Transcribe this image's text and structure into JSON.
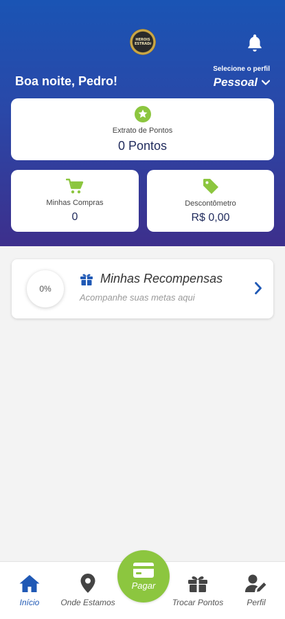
{
  "header": {
    "logo_text": "HERÓIS ESTRADA",
    "greeting": "Boa noite, Pedro!",
    "profile_label": "Selecione o perfil",
    "profile_value": "Pessoal"
  },
  "cards": {
    "points": {
      "label": "Extrato de Pontos",
      "value": "0 Pontos"
    },
    "purchases": {
      "label": "Minhas Compras",
      "value": "0"
    },
    "discount": {
      "label": "Descontômetro",
      "value": "R$ 0,00"
    }
  },
  "rewards": {
    "progress": "0%",
    "title": "Minhas Recompensas",
    "subtitle": "Acompanhe suas metas aqui"
  },
  "nav": {
    "home": "Início",
    "where": "Onde Estamos",
    "pay": "Pagar",
    "exchange": "Trocar Pontos",
    "profile": "Perfil"
  },
  "colors": {
    "accent_green": "#8cc63f",
    "brand_blue": "#2059b5",
    "header_gradient_top": "#1a54b4",
    "header_gradient_bottom": "#3d2f8c"
  }
}
